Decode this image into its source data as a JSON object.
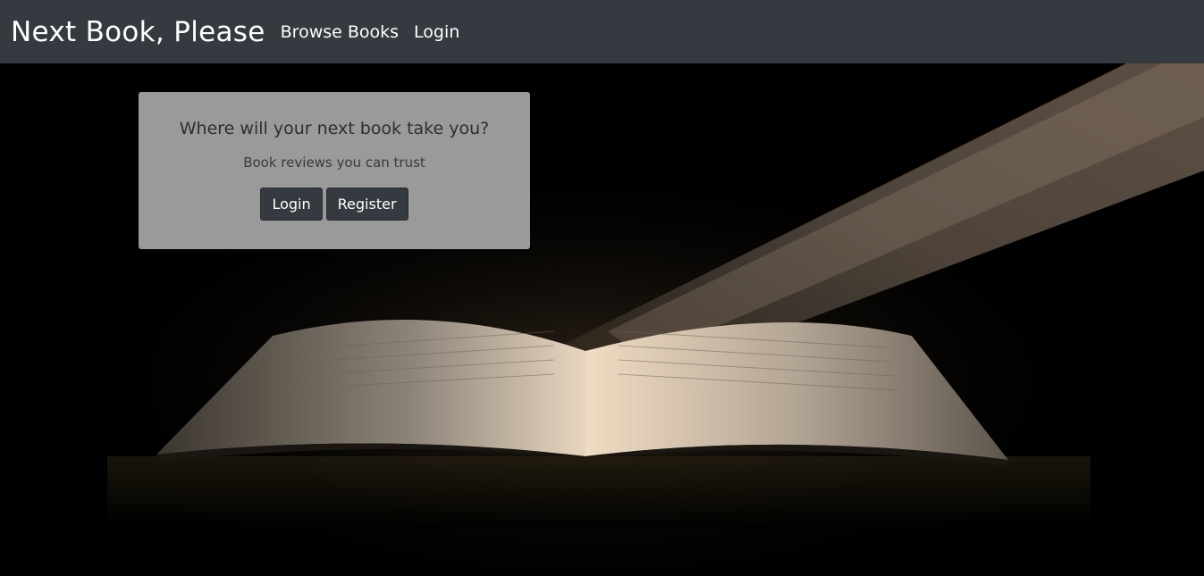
{
  "navbar": {
    "brand": "Next Book, Please",
    "links": [
      {
        "label": "Browse Books"
      },
      {
        "label": "Login"
      }
    ]
  },
  "hero": {
    "background_image": "open-book-in-spotlight",
    "card": {
      "title": "Where will your next book take you?",
      "subtitle": "Book reviews you can trust",
      "login_label": "Login",
      "register_label": "Register"
    }
  },
  "colors": {
    "navbar_bg": "#343a40",
    "card_bg": "#9a9a9a",
    "button_bg": "#343a40"
  }
}
